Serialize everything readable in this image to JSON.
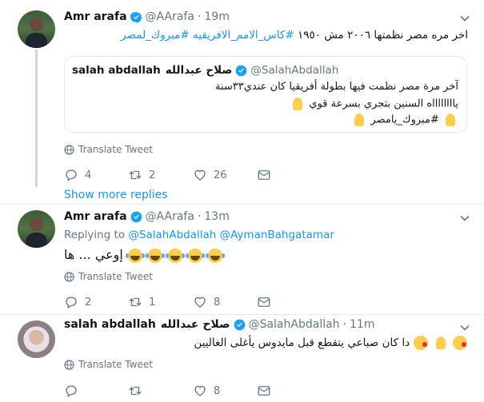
{
  "tweet1": {
    "name": "Amr arafa",
    "handle": "@AArafa",
    "dot": "·",
    "time": "19m",
    "text_main": "اخر مره مصر نظمتها ٢٠٠٦ مش ١٩٥٠",
    "text_hashtags": "#كاس_الامم_الافريقيه #مبروك_لمصر",
    "quote": {
      "name": "salah abdallah",
      "display_ar": "صلاح عبدالله",
      "handle": "@SalahAbdallah",
      "line1": "آخر مرة مصر نظمت فيها بطولة أفريقيا كان عندي٣٣سنة",
      "line2": "يااااااااه السنين بتجري بسرعة قوي",
      "line3": "#مبروك_يامصر"
    },
    "translate": "Translate Tweet",
    "replies": "4",
    "retweets": "2",
    "likes": "26"
  },
  "show_more": "Show more replies",
  "tweet2": {
    "name": "Amr arafa",
    "handle": "@AArafa",
    "dot": "·",
    "time": "13m",
    "replying_prefix": "Replying to",
    "replying_to_1": "@SalahAbdallah",
    "replying_to_2": "@AymanBahgatamar",
    "text": "إوعي ... ها",
    "translate": "Translate Tweet",
    "replies": "2",
    "retweets": "1",
    "likes": "8"
  },
  "tweet3": {
    "name": "salah abdallah",
    "display_ar": "صلاح عبدالله",
    "handle": "@SalahAbdallah",
    "dot": "·",
    "time": "11m",
    "text": "دا كان صباعي يتقطع قبل مايدوس يأغلى الغاليين",
    "translate": "Translate Tweet",
    "replies": "",
    "retweets": "",
    "likes": "8"
  },
  "colors": {
    "accent": "#1b95e0",
    "muted": "#657786",
    "verified": "#1da1f2",
    "line": "#ccd6dd"
  },
  "icons": [
    "verified-badge-icon",
    "caret-down-icon",
    "globe-icon",
    "reply-icon",
    "retweet-icon",
    "like-icon",
    "direct-message-icon"
  ]
}
